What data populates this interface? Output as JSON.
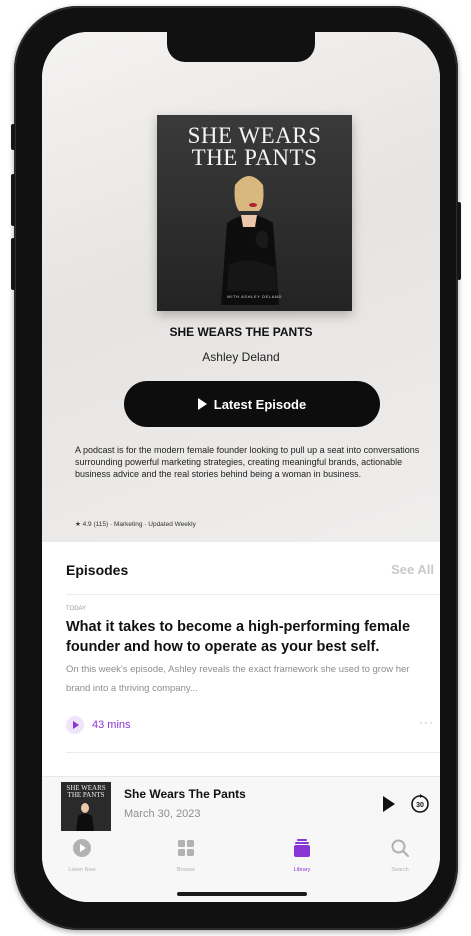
{
  "podcast": {
    "artwork_title": "SHE WEARS THE PANTS",
    "artwork_line1": "SHE WEARS",
    "artwork_line2": "THE PANTS",
    "artwork_byline": "WITH ASHLEY DELAND",
    "title": "SHE WEARS THE PANTS",
    "author": "Ashley Deland",
    "latest_episode_label": "Latest Episode",
    "description": "A podcast is for the modern female founder looking to pull up a seat into conversations surrounding powerful marketing strategies, creating meaningful brands, actionable business advice and the real stories behind being a woman in business.",
    "meta": "★ 4.9 (115) · Marketing · Updated Weekly"
  },
  "episodes": {
    "header": "Episodes",
    "see_all": "See All",
    "items": [
      {
        "date": "TODAY",
        "title": "What it takes to become a high-performing female founder and how to operate as your best self.",
        "description": "On this week's episode, Ashley reveals the exact framework she used to grow her brand into a thriving company...",
        "duration": "43 mins",
        "more": "···"
      }
    ]
  },
  "mini_player": {
    "title": "She Wears The Pants",
    "date": "March 30, 2023",
    "artwork_text": "SHE WEARS THE PANTS",
    "skip_label": "30"
  },
  "tabs": [
    {
      "label": "Listen Now",
      "icon": "play-circle-icon",
      "active": false
    },
    {
      "label": "Browse",
      "icon": "grid-icon",
      "active": false
    },
    {
      "label": "Library",
      "icon": "library-icon",
      "active": true
    },
    {
      "label": "Search",
      "icon": "search-icon",
      "active": false
    }
  ],
  "colors": {
    "accent": "#8a35d6",
    "button_bg": "#0d0d0d",
    "inactive_tab": "#b2b2b2"
  }
}
